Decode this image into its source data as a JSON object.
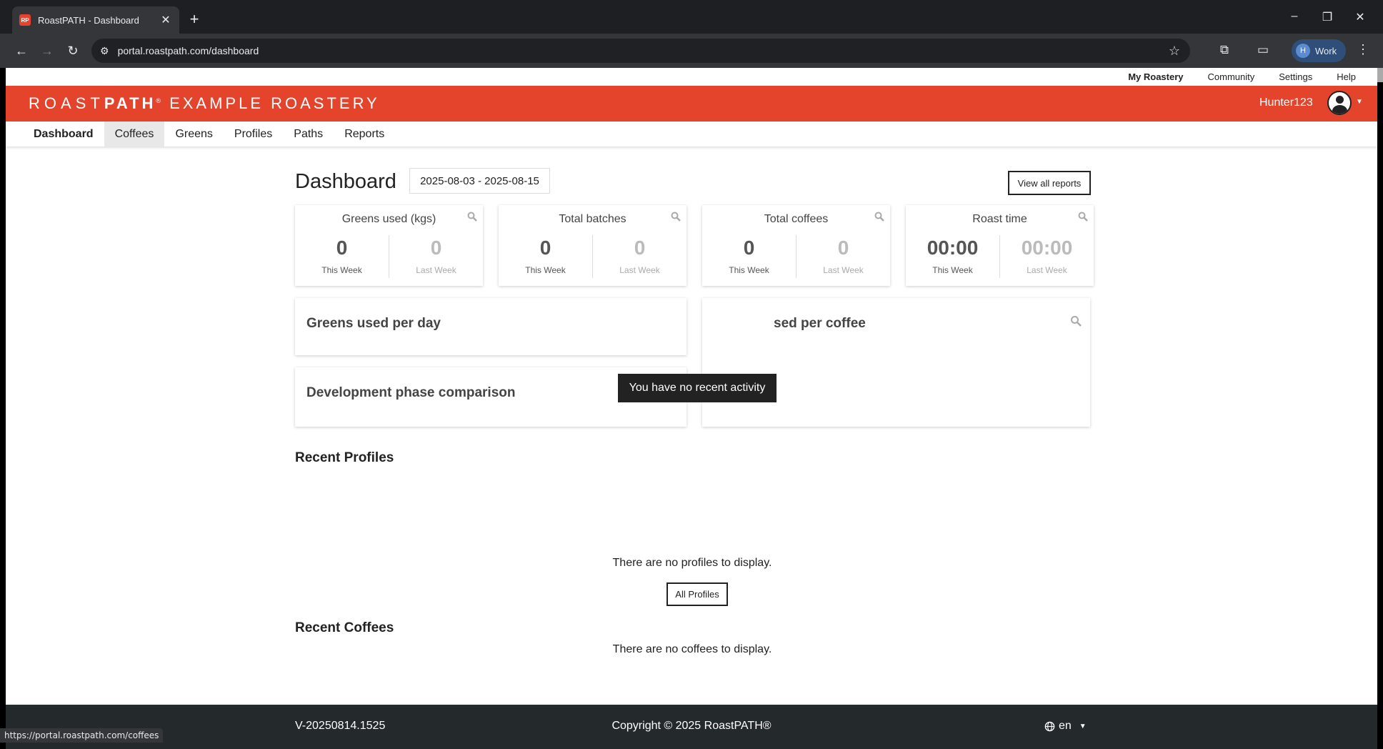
{
  "browser": {
    "tab_title": "RoastPATH - Dashboard",
    "favicon_text": "RP",
    "url": "portal.roastpath.com/dashboard",
    "profile_initial": "H",
    "profile_label": "Work",
    "status_url": "https://portal.roastpath.com/coffees"
  },
  "toplinks": [
    "My Roastery",
    "Community",
    "Settings",
    "Help"
  ],
  "brand": {
    "logo_light": "ROAST",
    "logo_bold": "PATH",
    "logo_mark": "®",
    "roastery": "EXAMPLE ROASTERY",
    "username": "Hunter123",
    "accent": "#e4432c"
  },
  "nav": [
    "Dashboard",
    "Coffees",
    "Greens",
    "Profiles",
    "Paths",
    "Reports"
  ],
  "dashboard": {
    "title": "Dashboard",
    "date_range": "2025-08-03 - 2025-08-15",
    "view_reports": "View all reports",
    "stats": [
      {
        "title": "Greens used (kgs)",
        "this_week": "0",
        "last_week": "0"
      },
      {
        "title": "Total batches",
        "this_week": "0",
        "last_week": "0"
      },
      {
        "title": "Total coffees",
        "this_week": "0",
        "last_week": "0"
      },
      {
        "title": "Roast time",
        "this_week": "00:00",
        "last_week": "00:00"
      }
    ],
    "this_week_label": "This Week",
    "last_week_label": "Last Week",
    "panels": {
      "greens_per_day": "Greens used per day",
      "greens_per_coffee": "sed per coffee",
      "dev_phase": "Development phase comparison"
    },
    "tooltip": "You have no recent activity",
    "recent_profiles": {
      "title": "Recent Profiles",
      "empty": "There are no profiles to display.",
      "button": "All Profiles"
    },
    "recent_coffees": {
      "title": "Recent Coffees",
      "empty": "There are no coffees to display."
    }
  },
  "footer": {
    "version": "V-20250814.1525",
    "copyright": "Copyright © 2025 RoastPATH®",
    "language": "en",
    "bg": "#24292c"
  }
}
